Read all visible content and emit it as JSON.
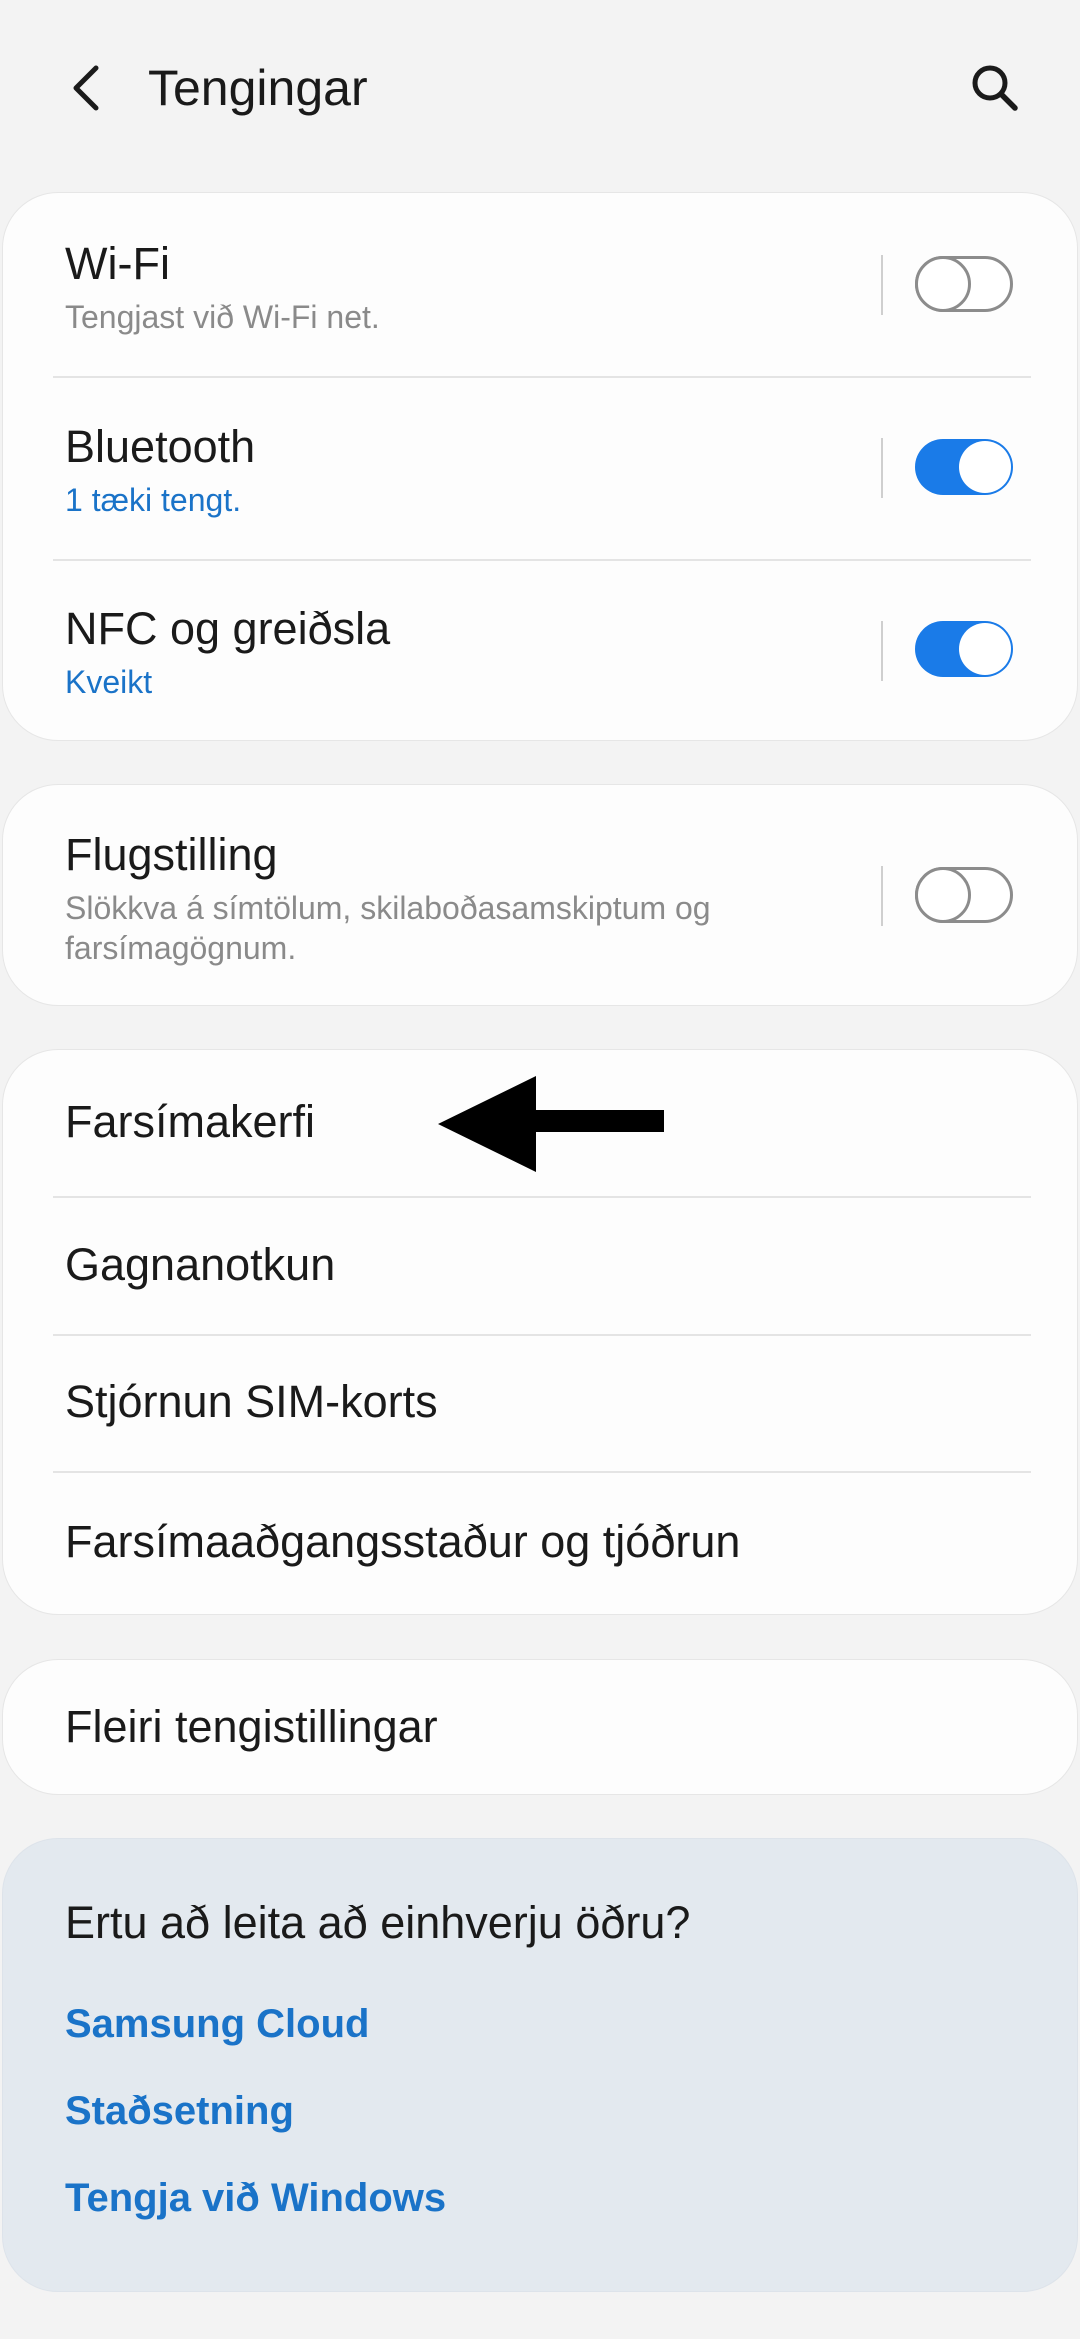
{
  "header": {
    "title": "Tengingar",
    "back_icon": "back-arrow-icon",
    "search_icon": "search-icon"
  },
  "connections": {
    "wifi": {
      "title": "Wi-Fi",
      "subtitle": "Tengjast við Wi-Fi net.",
      "toggle": "off"
    },
    "bluetooth": {
      "title": "Bluetooth",
      "subtitle": "1 tæki tengt.",
      "toggle": "on"
    },
    "nfc": {
      "title": "NFC og greiðsla",
      "subtitle": "Kveikt",
      "toggle": "on"
    }
  },
  "airplane": {
    "title": "Flugstilling",
    "subtitle": "Slökkva á símtölum, skilaboðasamskiptum og farsímagögnum.",
    "toggle": "off"
  },
  "network_items": [
    {
      "label": "Farsímakerfi"
    },
    {
      "label": "Gagnanotkun"
    },
    {
      "label": "Stjórnun SIM-korts"
    },
    {
      "label": "Farsímaaðgangsstaður og tjóðrun"
    }
  ],
  "more": {
    "label": "Fleiri tengistillingar"
  },
  "help": {
    "title": "Ertu að leita að einhverju öðru?",
    "links": [
      "Samsung Cloud",
      "Staðsetning",
      "Tengja við Windows"
    ]
  },
  "colors": {
    "accent": "#1a7be8",
    "link": "#1a73c8",
    "background": "#f3f3f3",
    "card": "#fdfdfd",
    "help_card": "#e3e9ef"
  }
}
